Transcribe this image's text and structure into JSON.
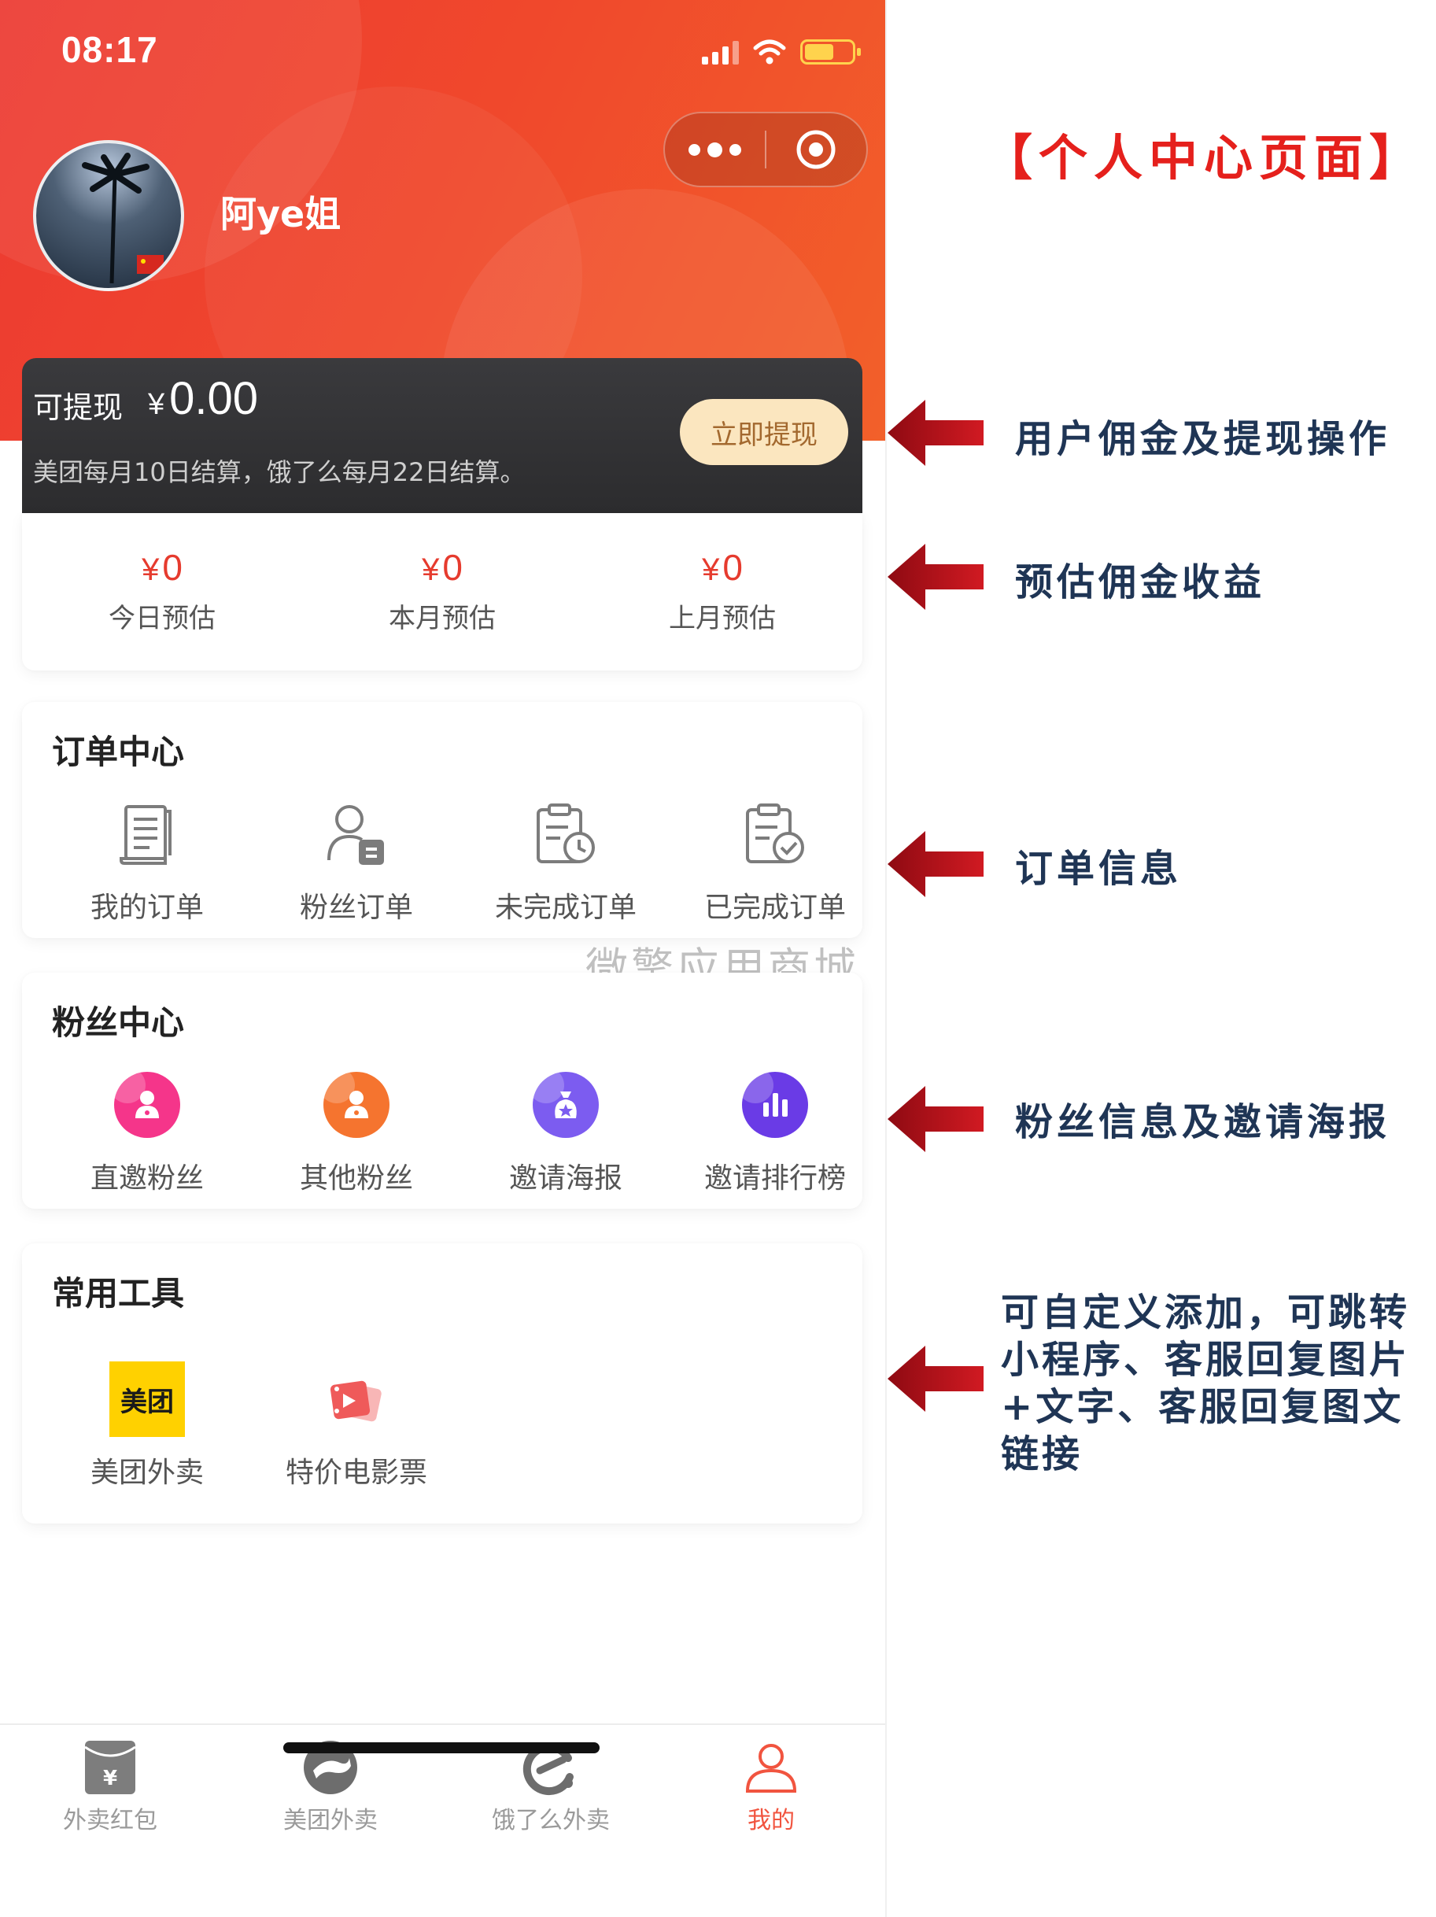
{
  "status_bar": {
    "time": "08:17"
  },
  "profile": {
    "username": "阿ye姐"
  },
  "withdraw": {
    "label": "可提现",
    "currency": "¥",
    "amount": "0.00",
    "note": "美团每月10日结算，饿了么每月22日结算。",
    "button": "立即提现"
  },
  "estimates": [
    {
      "currency": "¥",
      "value": "0",
      "label": "今日预估"
    },
    {
      "currency": "¥",
      "value": "0",
      "label": "本月预估"
    },
    {
      "currency": "¥",
      "value": "0",
      "label": "上月预估"
    }
  ],
  "order_center": {
    "title": "订单中心",
    "items": [
      {
        "label": "我的订单",
        "icon": "document-list-icon"
      },
      {
        "label": "粉丝订单",
        "icon": "user-clipboard-icon"
      },
      {
        "label": "未完成订单",
        "icon": "clipboard-clock-icon"
      },
      {
        "label": "已完成订单",
        "icon": "clipboard-check-icon"
      }
    ]
  },
  "watermark": "微擎应用商城",
  "fans_center": {
    "title": "粉丝中心",
    "items": [
      {
        "label": "直邀粉丝",
        "icon": "direct-fans-icon",
        "color": "#f5358a"
      },
      {
        "label": "其他粉丝",
        "icon": "other-fans-icon",
        "color": "#f5742f"
      },
      {
        "label": "邀请海报",
        "icon": "invite-poster-icon",
        "color": "#7c5cf0"
      },
      {
        "label": "邀请排行榜",
        "icon": "ranking-icon",
        "color": "#6a3be6"
      }
    ]
  },
  "tools": {
    "title": "常用工具",
    "items": [
      {
        "label": "美团外卖",
        "logo_text": "美团",
        "icon": "meituan-logo-icon"
      },
      {
        "label": "特价电影票",
        "icon": "movie-ticket-icon"
      }
    ]
  },
  "bottom_nav": [
    {
      "label": "外卖红包",
      "icon": "red-envelope-icon",
      "active": false
    },
    {
      "label": "美团外卖",
      "icon": "meituan-kangaroo-icon",
      "active": false
    },
    {
      "label": "饿了么外卖",
      "icon": "eleme-icon",
      "active": false
    },
    {
      "label": "我的",
      "icon": "user-profile-icon",
      "active": true
    }
  ],
  "annotations": {
    "title": "【个人中心页面】",
    "notes": [
      "用户佣金及提现操作",
      "预估佣金收益",
      "订单信息",
      "粉丝信息及邀请海报",
      "可自定义添加，可跳转小程序、客服回复图片+文字、客服回复图文链接"
    ]
  },
  "colors": {
    "header_red": "#ec3a32",
    "amount_red": "#e63b2e",
    "withdraw_button": "#fbe6bf",
    "active_tab": "#f1543f",
    "annotation_title": "#e5201c",
    "annotation_text": "#1f3555",
    "arrow": "#b0121a"
  }
}
